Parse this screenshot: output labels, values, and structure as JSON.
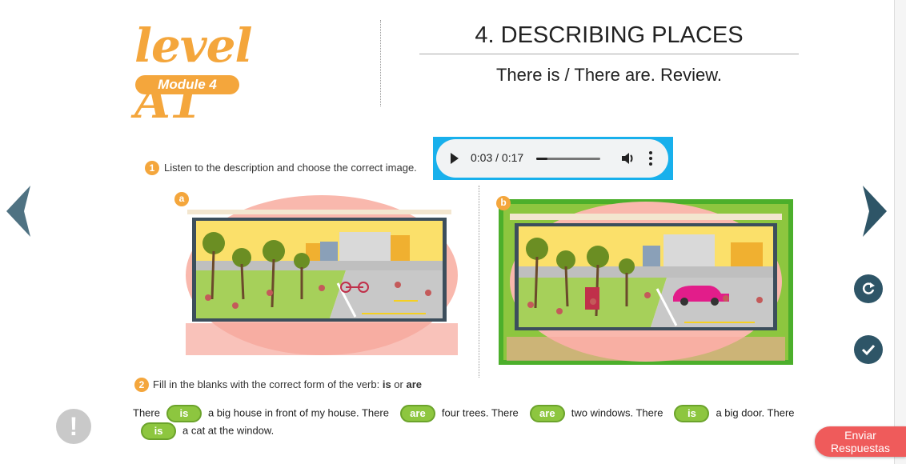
{
  "header": {
    "logo_level": "level A1",
    "logo_module": "Module 4",
    "title": "4. DESCRIBING PLACES",
    "subtitle": "There is / There are. Review."
  },
  "question1": {
    "number": "1",
    "instruction": "Listen to the description and choose the correct image.",
    "audio": {
      "time": "0:03 / 0:17",
      "progress": 0.18
    },
    "choices": [
      {
        "label": "a",
        "selected": false
      },
      {
        "label": "b",
        "selected": true
      }
    ]
  },
  "question2": {
    "number": "2",
    "instruction_prefix": "Fill in the blanks with the correct form of the verb: ",
    "option1": "is",
    "or": " or ",
    "option2": "are",
    "segments": [
      {
        "text": "There",
        "answer": "is"
      },
      {
        "text": "a big house in front of my house. There",
        "answer": "are"
      },
      {
        "text": "four trees. There",
        "answer": "are"
      },
      {
        "text": "two windows. There",
        "answer": "is"
      },
      {
        "text": "a big door. There",
        "answer": "is"
      },
      {
        "text": "a cat at the window.",
        "answer": null
      }
    ]
  },
  "buttons": {
    "alert": "!",
    "submit_line1": "Enviar",
    "submit_line2": "Respuestas"
  },
  "colors": {
    "accent_orange": "#f4a63c",
    "answer_green": "#8dc63f",
    "nav_teal": "#2e5567",
    "submit_red": "#ef5b5b"
  }
}
